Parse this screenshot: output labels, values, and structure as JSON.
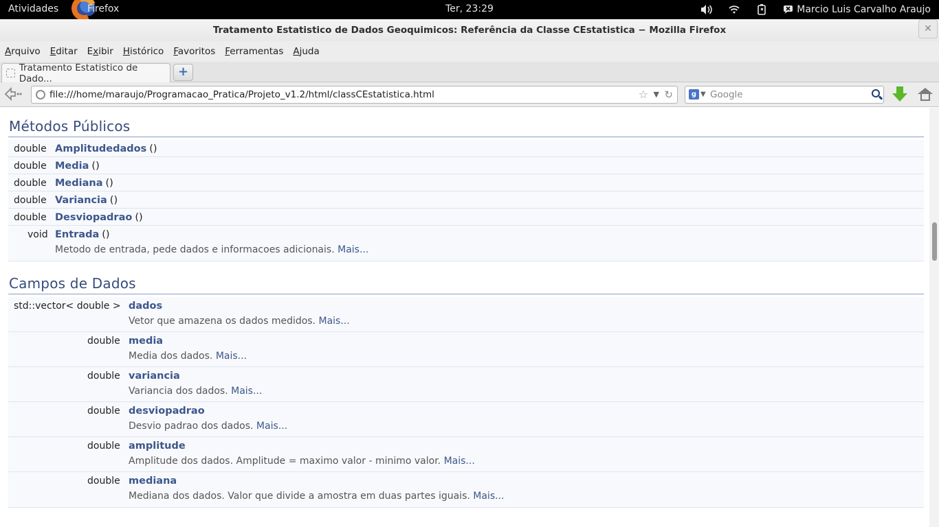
{
  "topbar": {
    "activities": "Atividades",
    "app_name": "Firefox",
    "clock": "Ter, 23:29",
    "user": "Marcio Luis Carvalho Araujo"
  },
  "window": {
    "title": "Tratamento Estatistico de Dados Geoquimicos: Referência da Classe CEstatistica − Mozilla Firefox",
    "close": "✕"
  },
  "menu": {
    "arquivo": {
      "accel": "A",
      "rest": "rquivo"
    },
    "editar": {
      "accel": "E",
      "rest": "ditar"
    },
    "exibir": {
      "accel": "x",
      "pre": "E",
      "rest": "ibir"
    },
    "historico": {
      "accel": "H",
      "rest": "istórico"
    },
    "favoritos": {
      "accel": "F",
      "pre": "",
      "rest": "avoritos"
    },
    "ferramentas": {
      "accel": "F",
      "rest": "erramentas"
    },
    "ajuda": {
      "accel": "A",
      "rest": "juda"
    }
  },
  "tab": {
    "title": "Tratamento Estatistico de Dado..."
  },
  "nav": {
    "url": "file:///home/maraujo/Programacao_Pratica/Projeto_v1.2/html/classCEstatistica.html",
    "search_placeholder": "Google"
  },
  "icons": {
    "new_tab": "plus-icon",
    "back": "back-arrow-icon",
    "bookmark": "star-icon",
    "reload": "reload-icon",
    "search_engine": "google-icon",
    "search": "magnifier-icon",
    "downloads": "download-arrow-icon",
    "home": "home-icon"
  },
  "colors": {
    "link": "#3d578c",
    "heading": "#354c7b",
    "row_bg": "#f8f9fc",
    "download_green": "#5cb82a"
  },
  "methods": {
    "title": "Métodos Públicos",
    "items": [
      {
        "type": "double",
        "name": "Amplitudedados",
        "params": "()"
      },
      {
        "type": "double",
        "name": "Media",
        "params": "()"
      },
      {
        "type": "double",
        "name": "Mediana",
        "params": "()"
      },
      {
        "type": "double",
        "name": "Variancia",
        "params": "()"
      },
      {
        "type": "double",
        "name": "Desviopadrao",
        "params": "()"
      },
      {
        "type": "void",
        "name": "Entrada",
        "params": "()",
        "desc": "Metodo de entrada, pede dados e informacoes adicionais.",
        "more": "Mais..."
      }
    ]
  },
  "fields": {
    "title": "Campos de Dados",
    "items": [
      {
        "type": "std::vector< double >",
        "name": "dados",
        "desc": "Vetor que amazena os dados medidos.",
        "more": "Mais..."
      },
      {
        "type": "double",
        "name": "media",
        "desc": "Media dos dados.",
        "more": "Mais..."
      },
      {
        "type": "double",
        "name": "variancia",
        "desc": "Variancia dos dados.",
        "more": "Mais..."
      },
      {
        "type": "double",
        "name": "desviopadrao",
        "desc": "Desvio padrao dos dados.",
        "more": "Mais..."
      },
      {
        "type": "double",
        "name": "amplitude",
        "desc": "Amplitude dos dados. Amplitude = maximo valor - minimo valor.",
        "more": "Mais..."
      },
      {
        "type": "double",
        "name": "mediana",
        "desc": "Mediana dos dados. Valor que divide a amostra em duas partes iguais.",
        "more": "Mais..."
      }
    ]
  }
}
